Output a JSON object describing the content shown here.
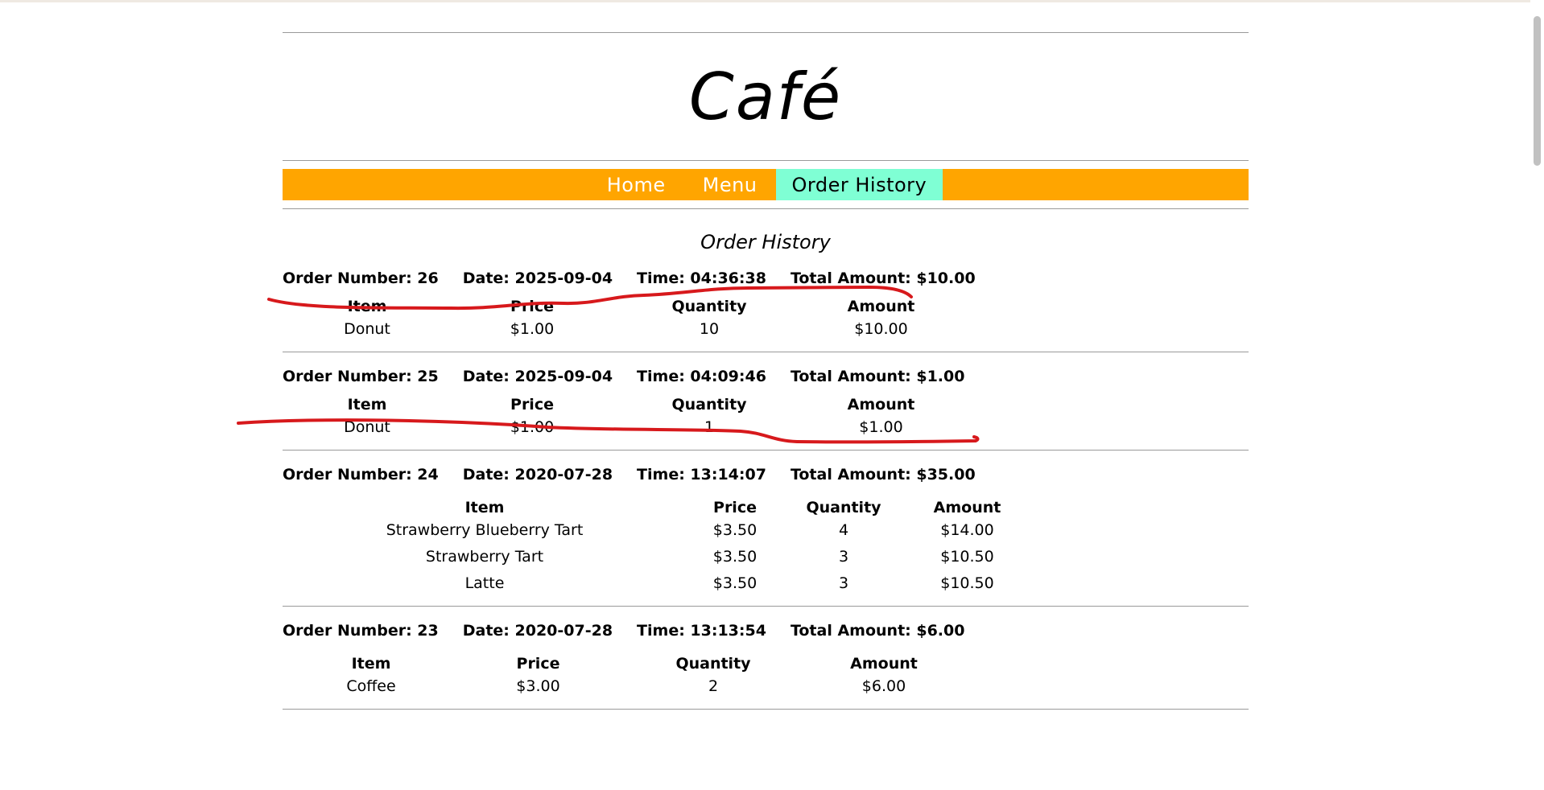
{
  "site": {
    "title": "Café"
  },
  "nav": [
    {
      "label": "Home",
      "active": false
    },
    {
      "label": "Menu",
      "active": false
    },
    {
      "label": "Order History",
      "active": true
    }
  ],
  "page": {
    "heading": "Order History"
  },
  "columns": {
    "item": "Item",
    "price": "Price",
    "quantity": "Quantity",
    "amount": "Amount"
  },
  "orders": [
    {
      "number_text": "Order Number: 26",
      "date_text": "Date: 2025-09-04",
      "time_text": "Time: 04:36:38",
      "total_text": "Total Amount: $10.00",
      "items": [
        {
          "item": "Donut",
          "price": "$1.00",
          "quantity": "10",
          "amount": "$10.00"
        }
      ]
    },
    {
      "number_text": "Order Number: 25",
      "date_text": "Date: 2025-09-04",
      "time_text": "Time: 04:09:46",
      "total_text": "Total Amount: $1.00",
      "items": [
        {
          "item": "Donut",
          "price": "$1.00",
          "quantity": "1",
          "amount": "$1.00"
        }
      ]
    },
    {
      "number_text": "Order Number: 24",
      "date_text": "Date: 2020-07-28",
      "time_text": "Time: 13:14:07",
      "total_text": "Total Amount: $35.00",
      "items": [
        {
          "item": "Strawberry Blueberry Tart",
          "price": "$3.50",
          "quantity": "4",
          "amount": "$14.00"
        },
        {
          "item": "Strawberry Tart",
          "price": "$3.50",
          "quantity": "3",
          "amount": "$10.50"
        },
        {
          "item": "Latte",
          "price": "$3.50",
          "quantity": "3",
          "amount": "$10.50"
        }
      ]
    },
    {
      "number_text": "Order Number: 23",
      "date_text": "Date: 2020-07-28",
      "time_text": "Time: 13:13:54",
      "total_text": "Total Amount: $6.00",
      "items": [
        {
          "item": "Coffee",
          "price": "$3.00",
          "quantity": "2",
          "amount": "$6.00"
        }
      ]
    }
  ],
  "colors": {
    "nav_bg": "#ffa500",
    "nav_active_bg": "#7fffd4",
    "annotation": "#d7191c"
  }
}
